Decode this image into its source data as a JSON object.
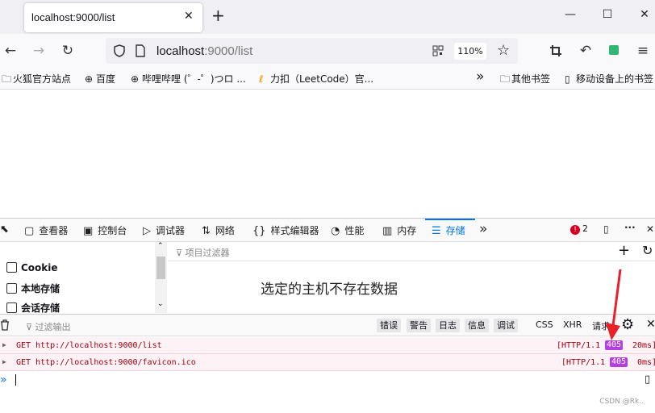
{
  "tab": {
    "title": "localhost:9000/list"
  },
  "window": {
    "minimize": "—",
    "maximize": "☐",
    "close": "✕"
  },
  "url": {
    "host": "localhost",
    "rest": ":9000/list",
    "zoom": "110%"
  },
  "bookmarks": {
    "items": [
      "火狐官方站点",
      "百度",
      "哔哩哔哩 (゜-゜)つロ ...",
      "力扣（LeetCode）官..."
    ],
    "more": "»",
    "other": "其他书签",
    "mobile": "移动设备上的书签"
  },
  "devtools": {
    "tabs": [
      "查看器",
      "控制台",
      "调试器",
      "网络",
      "样式编辑器",
      "性能",
      "内存",
      "存储"
    ],
    "active_tab": "存储",
    "error_count": "2",
    "storage": {
      "sidebar": [
        "Cookie",
        "本地存储",
        "会话存储"
      ],
      "filter_placeholder": "项目过滤器",
      "empty_message": "选定的主机不存在数据"
    },
    "console": {
      "filter_placeholder": "过滤输出",
      "levels": [
        "错误",
        "警告",
        "日志",
        "信息",
        "调试"
      ],
      "types": [
        "CSS",
        "XHR",
        "请求"
      ],
      "logs": [
        {
          "text": "GET http://localhost:9000/list",
          "protocol": "[HTTP/1.1",
          "status": "405",
          "time": "20ms]"
        },
        {
          "text": "GET http://localhost:9000/favicon.ico",
          "protocol": "[HTTP/1.1",
          "status": "405",
          "time": "0ms]"
        }
      ],
      "prompt": "»"
    }
  },
  "watermark": "CSDN @Rk..",
  "colors": {
    "accent": "#0074e8",
    "error_row_bg": "#fdf2f5",
    "status_badge": "#b43fe0",
    "annotation_arrow": "#e8202a"
  }
}
